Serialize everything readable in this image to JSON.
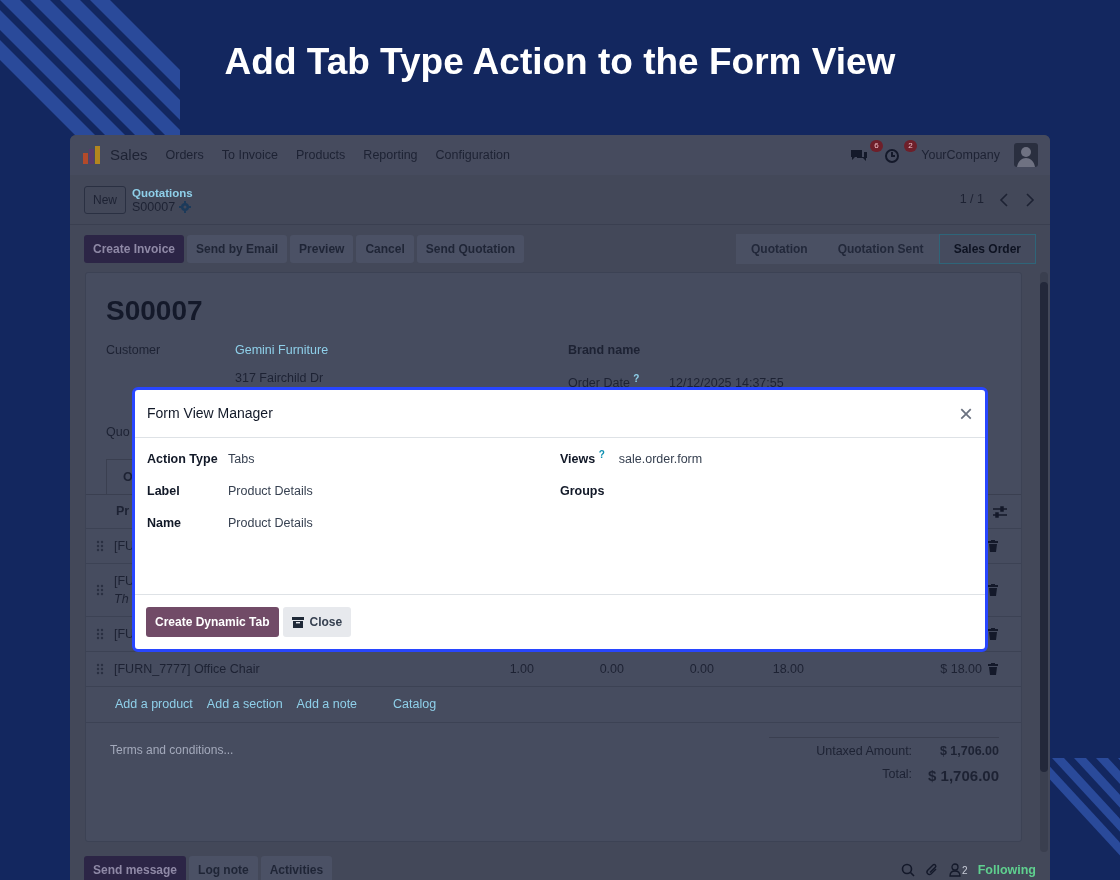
{
  "banner": {
    "title": "Add Tab Type Action to the Form View"
  },
  "navbar": {
    "app": "Sales",
    "menu": [
      "Orders",
      "To Invoice",
      "Products",
      "Reporting",
      "Configuration"
    ],
    "messages_badge": "6",
    "activities_badge": "2",
    "company": "YourCompany"
  },
  "control_panel": {
    "new_button": "New",
    "breadcrumb": "Quotations",
    "record": "S00007",
    "pager": "1 / 1"
  },
  "actions": [
    {
      "label": "Create Invoice",
      "primary": true
    },
    {
      "label": "Send by Email",
      "primary": false
    },
    {
      "label": "Preview",
      "primary": false
    },
    {
      "label": "Cancel",
      "primary": false
    },
    {
      "label": "Send Quotation",
      "primary": false
    }
  ],
  "status_steps": [
    {
      "label": "Quotation",
      "selected": false
    },
    {
      "label": "Quotation Sent",
      "selected": false
    },
    {
      "label": "Sales Order",
      "selected": true
    }
  ],
  "sheet": {
    "title": "S00007",
    "customer_label": "Customer",
    "customer": "Gemini Furniture",
    "address": "317 Fairchild Dr",
    "brand_label": "Brand name",
    "order_date_label": "Order Date",
    "order_date_help": "?",
    "order_date": "12/12/2025 14:37:55",
    "cut_label": "Quo",
    "cut_tab": "O",
    "column_1": "Pr",
    "lines": [
      {
        "product": "[FU"
      },
      {
        "product": "[FU",
        "note": "Th"
      },
      {
        "product": "[FU"
      },
      {
        "product": "[FURN_7777] Office Chair",
        "quantity": "1.00",
        "column_3": "0.00",
        "column_4": "0.00",
        "column_5": "18.00",
        "subtotal": "$ 18.00"
      }
    ],
    "add_links": [
      "Add a product",
      "Add a section",
      "Add a note"
    ],
    "catalog": "Catalog",
    "terms_placeholder": "Terms and conditions...",
    "untaxed_label": "Untaxed Amount:",
    "untaxed": "$ 1,706.00",
    "total_label": "Total:",
    "total": "$ 1,706.00"
  },
  "chatter": {
    "buttons": [
      {
        "label": "Send message",
        "primary": true
      },
      {
        "label": "Log note",
        "primary": false
      },
      {
        "label": "Activities",
        "primary": false
      }
    ],
    "followers": "2",
    "follow": "Following"
  },
  "dialog": {
    "title": "Form View Manager",
    "close": "×",
    "left_fields": [
      {
        "label": "Action Type",
        "value": "Tabs"
      },
      {
        "label": "Label",
        "value": "Product Details"
      },
      {
        "label": "Name",
        "value": "Product Details"
      }
    ],
    "right_fields": [
      {
        "label": "Views",
        "help": "?",
        "value": "sale.order.form"
      },
      {
        "label": "Groups"
      }
    ],
    "buttons": [
      {
        "label": "Create Dynamic Tab",
        "primary": true
      },
      {
        "label": "Close",
        "primary": false
      }
    ]
  }
}
